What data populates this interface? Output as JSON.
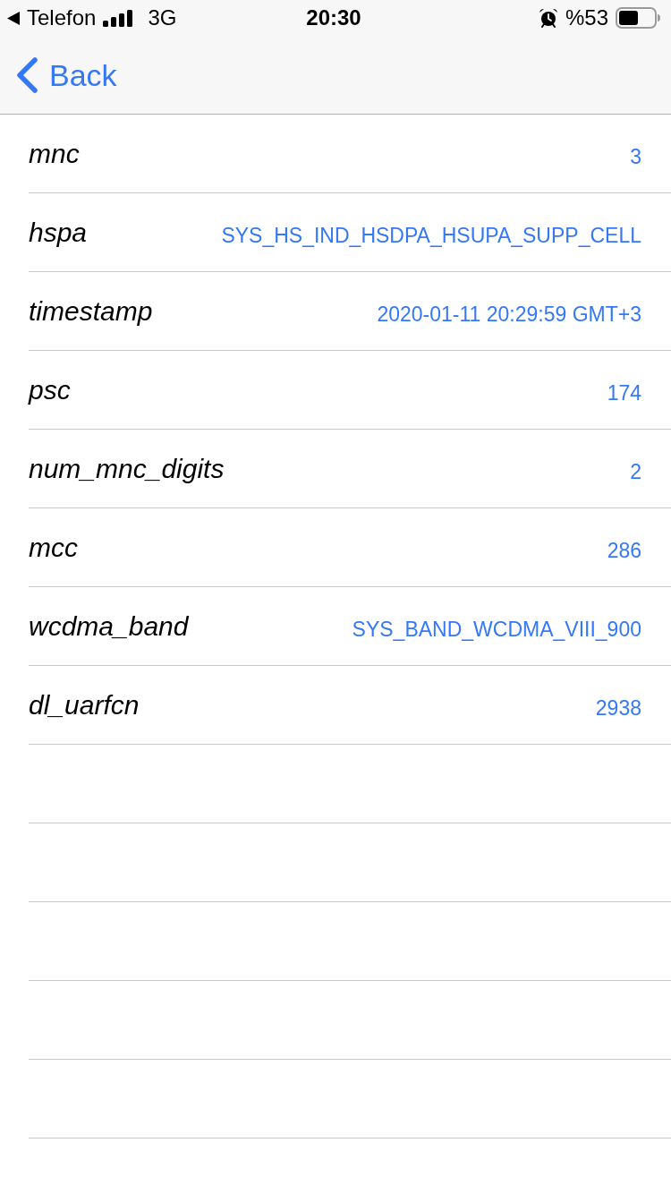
{
  "status_bar": {
    "back_app": "Telefon",
    "network": "3G",
    "time": "20:30",
    "battery": "%53"
  },
  "nav_bar": {
    "back_label": "Back"
  },
  "rows": [
    {
      "key": "mnc",
      "value": "3"
    },
    {
      "key": "hspa",
      "value": "SYS_HS_IND_HSDPA_HSUPA_SUPP_CELL"
    },
    {
      "key": "timestamp",
      "value": "2020-01-11 20:29:59 GMT+3"
    },
    {
      "key": "psc",
      "value": "174"
    },
    {
      "key": "num_mnc_digits",
      "value": "2"
    },
    {
      "key": "mcc",
      "value": "286"
    },
    {
      "key": "wcdma_band",
      "value": "SYS_BAND_WCDMA_VIII_900"
    },
    {
      "key": "dl_uarfcn",
      "value": "2938"
    }
  ]
}
